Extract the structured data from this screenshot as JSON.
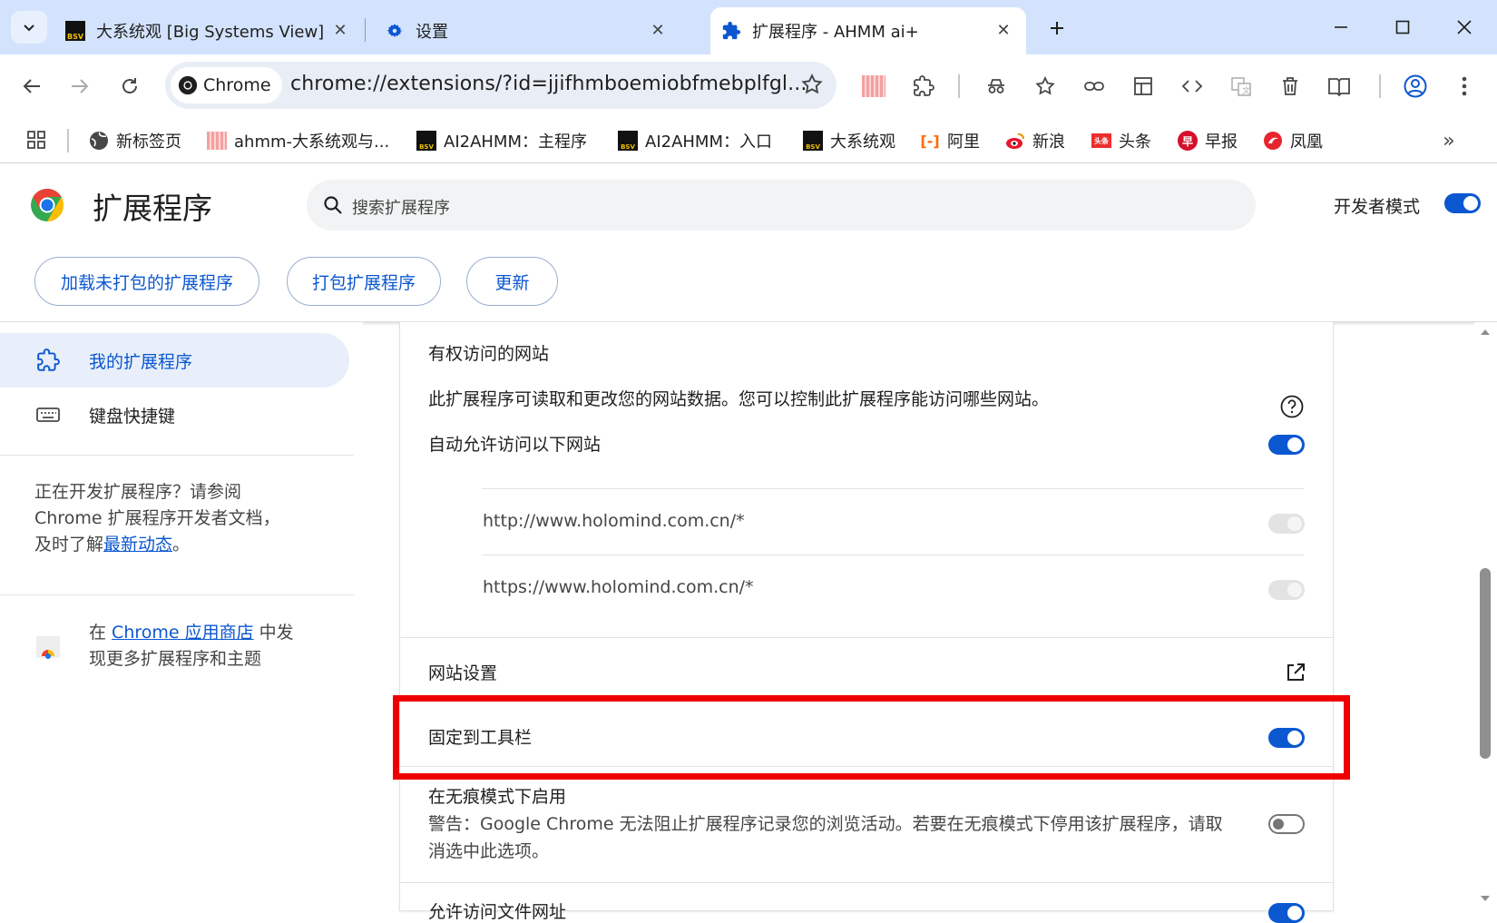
{
  "tabs": [
    {
      "title": "大系统观 [Big Systems View]",
      "icon": "bsv-icon"
    },
    {
      "title": "设置",
      "icon": "gear-icon"
    },
    {
      "title": "扩展程序 - AHMM ai+",
      "icon": "puzzle-icon"
    }
  ],
  "omnibox": {
    "chip_label": "Chrome",
    "url": "chrome://extensions/?id=jjifhmboemiobfmebplfgl..."
  },
  "bookmarks": [
    {
      "label": "新标签页",
      "icon": "globe-icon"
    },
    {
      "label": "ahmm-大系统观与...",
      "icon": "ahmm-icon"
    },
    {
      "label": "AI2AHMM：主程序",
      "icon": "bsv-icon"
    },
    {
      "label": "AI2AHMM：入口",
      "icon": "bsv-icon"
    },
    {
      "label": "大系统观",
      "icon": "bsv-icon"
    },
    {
      "label": "阿里",
      "icon": "aliyun-icon"
    },
    {
      "label": "新浪",
      "icon": "weibo-icon"
    },
    {
      "label": "头条",
      "icon": "toutiao-icon"
    },
    {
      "label": "早报",
      "icon": "zaobao-icon"
    },
    {
      "label": "凤凰",
      "icon": "ifeng-icon"
    }
  ],
  "header": {
    "title": "扩展程序",
    "search_placeholder": "搜索扩展程序",
    "dev_mode_label": "开发者模式",
    "dev_mode": true,
    "buttons": {
      "load_unpacked": "加载未打包的扩展程序",
      "pack": "打包扩展程序",
      "update": "更新"
    }
  },
  "sidebar": {
    "items": [
      {
        "label": "我的扩展程序",
        "selected": true
      },
      {
        "label": "键盘快捷键",
        "selected": false
      }
    ],
    "dev_note_line1": "正在开发扩展程序？请参阅",
    "dev_note_line2": "Chrome 扩展程序开发者文档，",
    "dev_note_line3_prefix": "及时了解",
    "dev_note_link": "最新动态",
    "dev_note_suffix": "。",
    "store_prefix": "在 ",
    "store_link": "Chrome 应用商店",
    "store_suffix": " 中发",
    "store_line2": "现更多扩展程序和主题"
  },
  "details": {
    "site_access_heading": "有权访问的网站",
    "site_access_desc": "此扩展程序可读取和更改您的网站数据。您可以控制此扩展程序能访问哪些网站。",
    "auto_allow_label": "自动允许访问以下网站",
    "auto_allow": true,
    "sites": [
      "http://www.holomind.com.cn/*",
      "https://www.holomind.com.cn/*"
    ],
    "site_settings_label": "网站设置",
    "pin_label": "固定到工具栏",
    "pin": true,
    "incognito_label": "在无痕模式下启用",
    "incognito_warning_line1": "警告：Google Chrome 无法阻止扩展程序记录您的浏览活动。若要在无痕模式下停用该扩展程序，请取",
    "incognito_warning_line2": "消选中此选项。",
    "incognito": false,
    "file_urls_label": "允许访问文件网址"
  },
  "colors": {
    "accent": "#0b57d0",
    "tabstrip": "#d3e3fd",
    "highlight": "#ee0000"
  }
}
